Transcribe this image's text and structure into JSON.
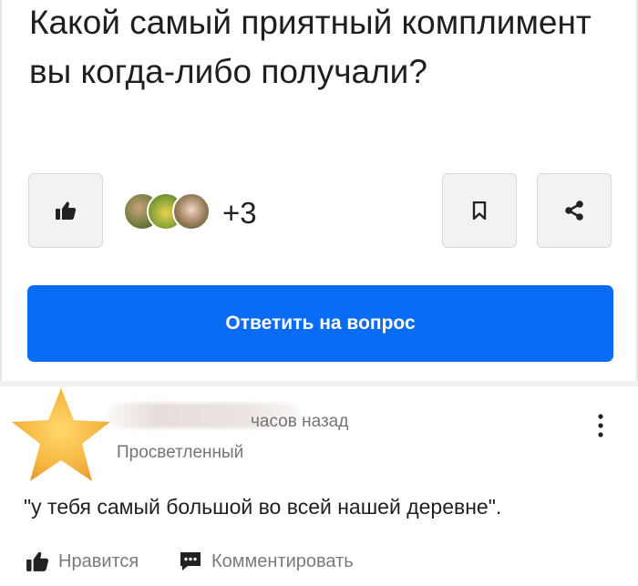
{
  "question": {
    "title": "Какой самый приятный комплимент вы когда-либо получали?",
    "participants_extra": "+3",
    "answer_button": "Ответить на вопрос"
  },
  "icons": {
    "like": "thumbs-up-icon",
    "bookmark": "bookmark-icon",
    "share": "share-icon",
    "more": "vertical-dots-icon",
    "comment": "comment-icon"
  },
  "answer": {
    "time_ago": "часов назад",
    "rank": "Просветленный",
    "text": "\"у тебя самый большой во всей нашей деревне\".",
    "like_label": "Нравится",
    "comment_label": "Комментировать"
  },
  "colors": {
    "accent": "#0a6cf5",
    "star": "#f5b53f",
    "muted_text": "#757575"
  }
}
